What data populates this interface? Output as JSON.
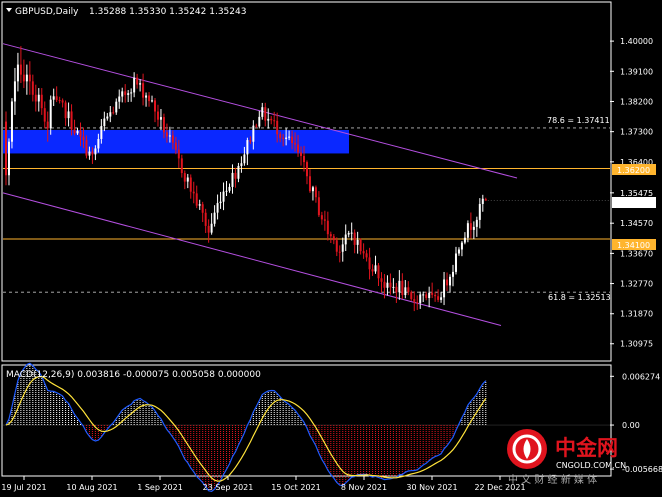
{
  "header": {
    "symbol": "GBPUSD,Daily",
    "ohlc": "1.35288 1.35330 1.35242 1.35243"
  },
  "macd_header": "MACD(12,26,9) 0.003816 -0.000075 0.005058 0.000000",
  "levels": {
    "fib_786_label": "78.6 = 1.37411",
    "fib_618_label": "61.8 = 1.32513",
    "res_label": "1.36200",
    "sup_label": "1.34100",
    "current_label": "1.35243"
  },
  "price_axis": [
    "1.40000",
    "1.39100",
    "1.38200",
    "1.37300",
    "1.36400",
    "1.35475",
    "1.34570",
    "1.33670",
    "1.32770",
    "1.31870",
    "1.30975"
  ],
  "macd_axis": [
    "0.006274",
    "0.00",
    "-0.005668"
  ],
  "date_axis": [
    "19 Jul 2021",
    "10 Aug 2021",
    "1 Sep 2021",
    "23 Sep 2021",
    "15 Oct 2021",
    "8 Nov 2021",
    "30 Nov 2021",
    "22 Dec 2021"
  ],
  "watermark": {
    "brand": "中金网",
    "url": "CNGOLD.COM.CN",
    "slogan": "中 文 财 经 新 媒 体"
  },
  "colors": {
    "bull": "#ffffff",
    "bear": "#e0141e",
    "channel": "#b44fe0",
    "level": "#ffb52e",
    "zone": "#0a28ff",
    "macd_hist_pos": "#ffffff",
    "macd_hist_neg": "#e0141e",
    "macd_line": "#1f5bff",
    "signal_line": "#ffe33a"
  },
  "chart_data": {
    "type": "candlestick",
    "symbol": "GBPUSD",
    "timeframe": "Daily",
    "ylim": [
      1.3055,
      1.4057
    ],
    "start_date": "2021-07-16",
    "ohlc_first_15": [
      [
        1.376,
        1.379,
        1.357,
        1.36
      ],
      [
        1.36,
        1.371,
        1.357,
        1.37
      ],
      [
        1.37,
        1.383,
        1.368,
        1.382
      ],
      [
        1.382,
        1.392,
        1.378,
        1.388
      ],
      [
        1.388,
        1.3965,
        1.385,
        1.393
      ],
      [
        1.393,
        1.3985,
        1.3875,
        1.39
      ],
      [
        1.39,
        1.3945,
        1.386,
        1.388
      ],
      [
        1.388,
        1.393,
        1.384,
        1.39
      ],
      [
        1.39,
        1.394,
        1.384,
        1.388
      ],
      [
        1.388,
        1.39,
        1.382,
        1.384
      ],
      [
        1.384,
        1.387,
        1.379,
        1.382
      ],
      [
        1.382,
        1.386,
        1.379,
        1.384
      ],
      [
        1.384,
        1.386,
        1.378,
        1.38
      ],
      [
        1.38,
        1.382,
        1.374,
        1.376
      ],
      [
        1.376,
        1.379,
        1.37,
        1.374
      ]
    ],
    "close_path": [
      [
        0,
        1.36
      ],
      [
        5,
        1.39
      ],
      [
        12,
        1.384
      ],
      [
        20,
        1.379
      ],
      [
        24,
        1.372
      ],
      [
        29,
        1.365
      ],
      [
        33,
        1.376
      ],
      [
        38,
        1.382
      ],
      [
        43,
        1.388
      ],
      [
        48,
        1.383
      ],
      [
        54,
        1.372
      ],
      [
        58,
        1.364
      ],
      [
        62,
        1.356
      ],
      [
        66,
        1.348
      ],
      [
        68,
        1.343
      ],
      [
        72,
        1.354
      ],
      [
        77,
        1.361
      ],
      [
        81,
        1.369
      ],
      [
        85,
        1.379
      ],
      [
        89,
        1.376
      ],
      [
        93,
        1.372
      ],
      [
        97,
        1.368
      ],
      [
        100,
        1.362
      ],
      [
        104,
        1.352
      ],
      [
        108,
        1.343
      ],
      [
        112,
        1.338
      ],
      [
        116,
        1.343
      ],
      [
        120,
        1.336
      ],
      [
        124,
        1.332
      ],
      [
        128,
        1.326
      ],
      [
        132,
        1.327
      ],
      [
        136,
        1.322
      ],
      [
        140,
        1.325
      ],
      [
        144,
        1.322
      ],
      [
        147,
        1.327
      ],
      [
        150,
        1.333
      ],
      [
        153,
        1.342
      ],
      [
        155,
        1.344
      ],
      [
        158,
        1.348
      ],
      [
        161,
        1.3524
      ]
    ],
    "levels": {
      "resistance": 1.362,
      "support": 1.341,
      "fib_78_6": 1.37411,
      "fib_61_8": 1.32513
    },
    "zone": [
      1.3665,
      1.3735
    ],
    "channel": {
      "upper": [
        [
          0,
          1.399
        ],
        [
          155,
          1.363
        ]
      ],
      "lower": [
        [
          0,
          1.3545
        ],
        [
          150,
          1.319
        ]
      ]
    },
    "macd": {
      "params": "12,26,9",
      "value": 0.003816,
      "signal": -7.5e-05,
      "hist": 0.005058,
      "ylim": [
        -0.0063,
        0.0067
      ]
    }
  }
}
